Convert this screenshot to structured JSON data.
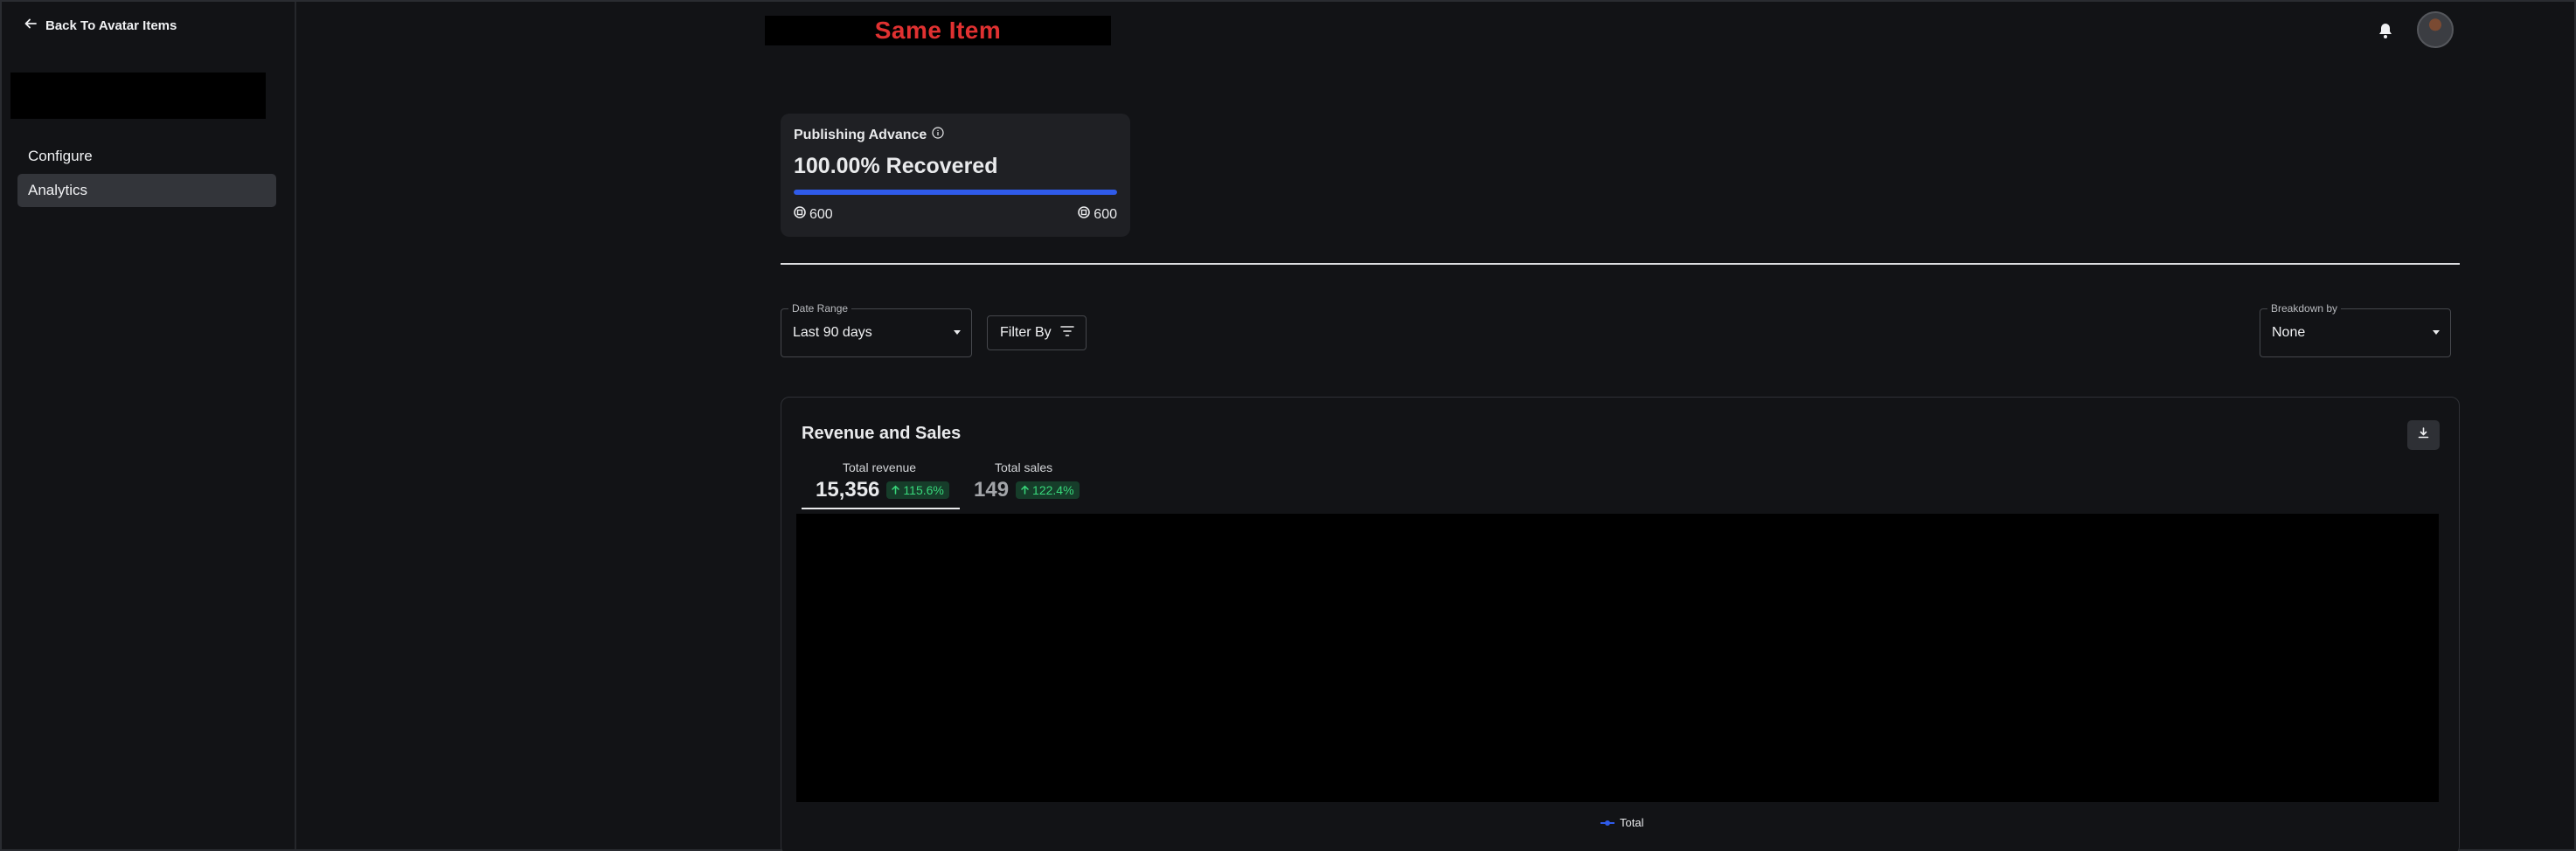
{
  "sidebar": {
    "back_label": "Back To Avatar Items",
    "items": [
      {
        "label": "Configure",
        "active": false
      },
      {
        "label": "Analytics",
        "active": true
      }
    ]
  },
  "header": {
    "title": "Same Item",
    "title_color": "#e03131"
  },
  "publishing": {
    "title": "Publishing Advance",
    "recovered_text": "100.00% Recovered",
    "progress_fraction": 1.0,
    "amount_left": "600",
    "amount_right": "600",
    "progress_color": "#2f5bea"
  },
  "filters": {
    "date_range_label": "Date Range",
    "date_range_value": "Last 90 days",
    "filter_label": "Filter By",
    "breakdown_label": "Breakdown by",
    "breakdown_value": "None"
  },
  "revenue_card": {
    "title": "Revenue and Sales",
    "metrics": [
      {
        "label": "Total revenue",
        "value": "15,356",
        "change": "115.6%",
        "selected": true
      },
      {
        "label": "Total sales",
        "value": "149",
        "change": "122.4%",
        "selected": false
      }
    ],
    "legend": "Total"
  },
  "icons": [
    "arrow-left-icon",
    "bell-icon",
    "info-icon",
    "robux-icon",
    "filter-icon",
    "download-icon",
    "arrow-up-icon",
    "chevron-down-icon"
  ],
  "colors": {
    "background": "#121316",
    "accent": "#2f5bea",
    "positive": "#38d97b"
  }
}
